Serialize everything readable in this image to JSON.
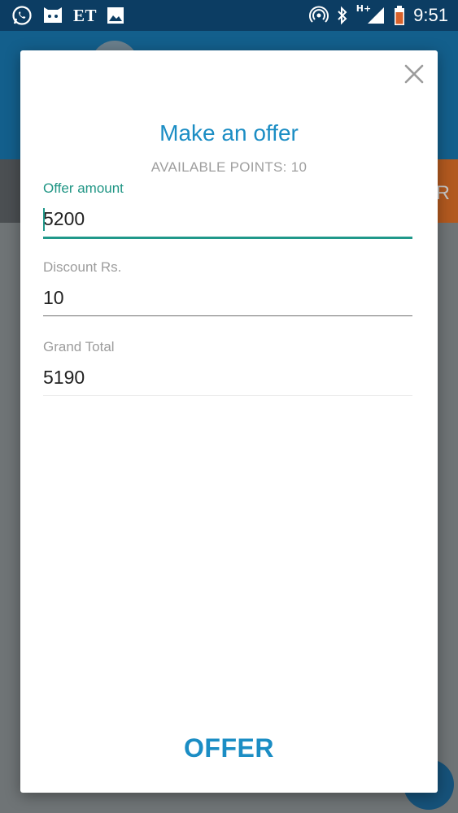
{
  "status_bar": {
    "left_icons": [
      "whatsapp-icon",
      "cat-app-icon",
      "image-icon"
    ],
    "et_text": "ET",
    "network_label": "H+",
    "right_icons": [
      "hotspot-icon",
      "bluetooth-icon",
      "signal-icon",
      "battery-icon"
    ],
    "time": "9:51"
  },
  "background": {
    "header_color": "#135f8c",
    "bar_partial_text": "R"
  },
  "dialog": {
    "title": "Make an offer",
    "available_points": "AVAILABLE POINTS: 10",
    "fields": [
      {
        "label": "Offer amount",
        "value": "5200"
      },
      {
        "label": "Discount Rs.",
        "value": "10"
      },
      {
        "label": "Grand Total",
        "value": "5190"
      }
    ],
    "offer_button": "OFFER",
    "accent_color": "#1b8dc4",
    "focus_color": "#20988a"
  }
}
